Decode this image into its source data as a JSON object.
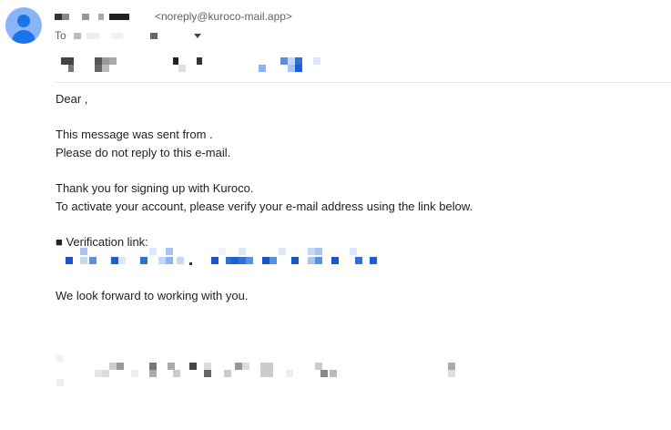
{
  "header": {
    "sender_email": "<noreply@kuroco-mail.app>",
    "to_label": "To"
  },
  "body": {
    "greeting": "Dear ,",
    "line_sent_from": "This message was sent from .",
    "line_no_reply": "Please do not reply to this e-mail.",
    "line_thanks": "Thank you for signing up with Kuroco.",
    "line_activate": "To activate your account, please verify your e-mail address using the link below.",
    "verification_label": "■ Verification link:",
    "closing": "We look forward to working with you."
  },
  "icons": {
    "avatar": "person-avatar-icon",
    "expand_recipients": "caret-down-icon"
  },
  "colors": {
    "avatar_bg": "#8ab4f8",
    "avatar_fg": "#1a73e8",
    "link_blue": "#1a73e8"
  }
}
